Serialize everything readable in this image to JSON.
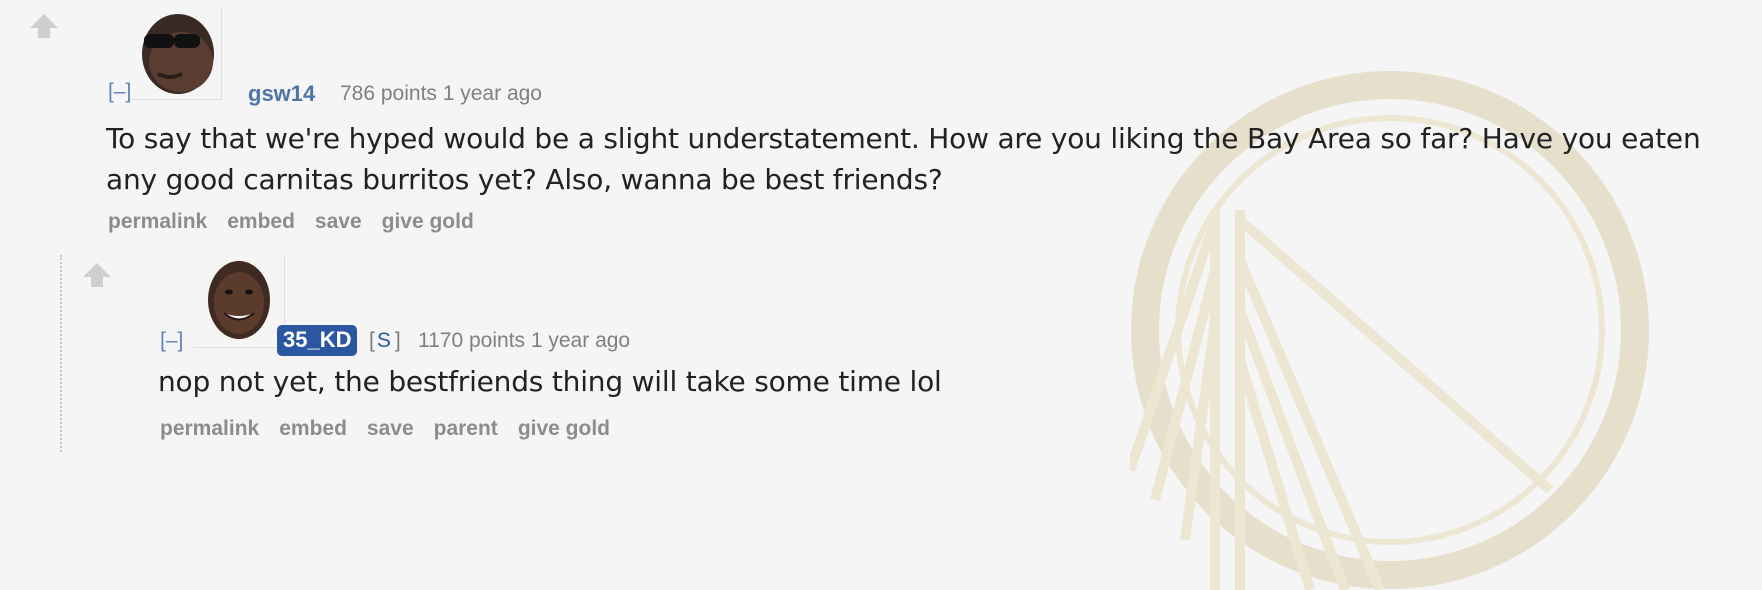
{
  "background": {
    "logo_name": "golden-state-bridge-watermark",
    "logo_color": "#e7dfc8"
  },
  "comments": [
    {
      "collapse_label": "[–]",
      "author": "gsw14",
      "meta": "786 points 1 year ago",
      "text": "To say that we're hyped would be a slight understatement. How are you liking the Bay Area so far? Have you eaten any good carnitas burritos yet? Also, wanna be best friends?",
      "actions": [
        "permalink",
        "embed",
        "save",
        "give gold"
      ],
      "avatar_icon": "sunglasses-avatar-icon"
    },
    {
      "collapse_label": "[–]",
      "author": "35_KD",
      "submitter_badge": {
        "left": "[",
        "s": "S",
        "right": "]"
      },
      "meta": "1170 points 1 year ago",
      "text": "nop not yet, the bestfriends thing will take some time lol",
      "actions": [
        "permalink",
        "embed",
        "save",
        "parent",
        "give gold"
      ],
      "avatar_icon": "smiling-face-avatar-icon"
    }
  ],
  "colors": {
    "author_link": "#4f74a8",
    "op_badge": "#2a57a0",
    "meta_text": "#808080",
    "action_text": "#8c8c8c",
    "background": "#f5f5f5"
  }
}
